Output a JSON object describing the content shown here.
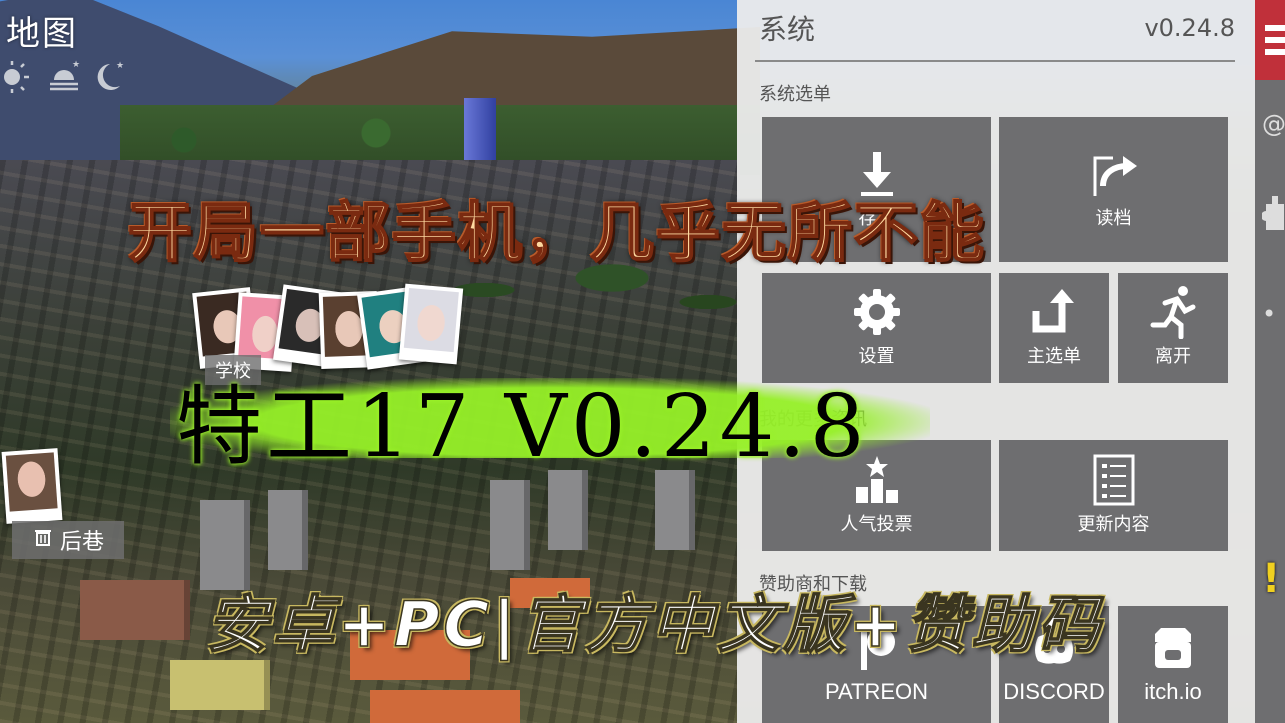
{
  "hud": {
    "map_title": "地图",
    "time_icons": [
      "sun-icon",
      "sunset-icon",
      "moon-icon"
    ],
    "school_label": "学校",
    "location_label": "后巷",
    "location_icon": "trash-can-icon"
  },
  "panel": {
    "title": "系统",
    "version": "v0.24.8",
    "section_system_menu": "系统选单",
    "section_news": "我的更多资讯",
    "section_sponsors": "赞助商和下载",
    "tiles": [
      {
        "id": "save",
        "label": "存档",
        "icon": "download-icon"
      },
      {
        "id": "load",
        "label": "读档",
        "icon": "share-arrow-icon"
      },
      {
        "id": "settings",
        "label": "设置",
        "icon": "gear-icon"
      },
      {
        "id": "main-menu",
        "label": "主选单",
        "icon": "return-arrow-icon"
      },
      {
        "id": "quit",
        "label": "离开",
        "icon": "running-man-icon"
      },
      {
        "id": "vote",
        "label": "人气投票",
        "icon": "podium-star-icon"
      },
      {
        "id": "changelog",
        "label": "更新内容",
        "icon": "list-document-icon"
      },
      {
        "id": "patreon",
        "label": "PATREON",
        "icon": "patreon-icon"
      },
      {
        "id": "discord",
        "label": "DISCORD",
        "icon": "discord-icon"
      },
      {
        "id": "itchio",
        "label": "itch.io",
        "icon": "itchio-icon"
      }
    ]
  },
  "rail": {
    "menu_icon": "hamburger-menu-icon",
    "icons": [
      "at-sign-icon",
      "puzzle-icon",
      "dot-icon"
    ]
  },
  "overlay": {
    "headline": "开局一部手机，几乎无所不能",
    "game_title": "特工17 V0.24.8",
    "subtitle": "安卓+PC|官方中文版+赞助码",
    "exclaim": "!"
  },
  "colors": {
    "panel_bg": "#ececec",
    "tile_bg": "#6e6e70",
    "rail_accent": "#c0303a",
    "headline_fill": "#ffd9a0",
    "title_glow": "#9cf22a"
  }
}
